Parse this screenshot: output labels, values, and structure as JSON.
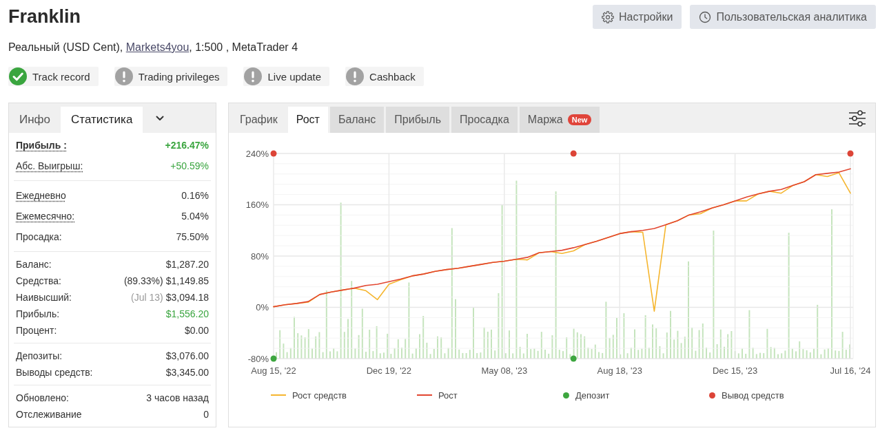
{
  "header": {
    "title": "Franklin",
    "buttons": [
      {
        "kind": "settings",
        "label": "Настройки"
      },
      {
        "kind": "analytics",
        "label": "Пользовательская аналитика"
      }
    ]
  },
  "account": {
    "text_before": "Реальный (USD Cent), ",
    "link": "Markets4you",
    "text_after": ", 1:500 , MetaTrader 4"
  },
  "badges": [
    {
      "label": "Track record",
      "verified": true
    },
    {
      "label": "Trading privileges",
      "verified": false
    },
    {
      "label": "Live update",
      "verified": false
    },
    {
      "label": "Cashback",
      "verified": false
    }
  ],
  "stats_panel": {
    "tabs": [
      {
        "label": "Инфо",
        "selected": false
      },
      {
        "label": "Статистика",
        "selected": true
      }
    ],
    "groups": [
      {
        "rows": [
          {
            "label": "Прибыль :",
            "value": "+216.47%",
            "hint": true,
            "emphasis": true,
            "positive": true
          },
          {
            "label": "Абс. Выигрыш:",
            "value": "+50.59%",
            "hint": true,
            "emphasis": false,
            "positive": true
          }
        ]
      },
      {
        "rows": [
          {
            "label": "Ежедневно",
            "value": "0.16%",
            "hint": true,
            "emphasis": false,
            "positive": false
          },
          {
            "label": "Ежемесячно:",
            "value": "5.04%",
            "hint": true,
            "emphasis": false,
            "positive": false
          },
          {
            "label": "Просадка:",
            "value": "75.50%",
            "hint": false,
            "emphasis": false,
            "positive": false
          }
        ]
      },
      {
        "rows": [
          {
            "label": "Баланс:",
            "value": "$1,287.20",
            "hint": false,
            "emphasis": false,
            "positive": false
          },
          {
            "label": "Средства:",
            "note": "(89.33%)",
            "note_muted": false,
            "value": "$1,149.85",
            "hint": false,
            "emphasis": false,
            "positive": false
          },
          {
            "label": "Наивысший:",
            "note": "(Jul 13)",
            "note_muted": true,
            "value": "$3,094.18",
            "hint": false,
            "emphasis": false,
            "positive": false
          },
          {
            "label": "Прибыль:",
            "value": "$1,556.20",
            "hint": false,
            "emphasis": false,
            "positive": true
          },
          {
            "label": "Процент:",
            "value": "$0.00",
            "hint": false,
            "emphasis": false,
            "positive": false
          }
        ]
      },
      {
        "rows": [
          {
            "label": "Депозиты:",
            "value": "$3,076.00",
            "hint": false,
            "emphasis": false,
            "positive": false
          },
          {
            "label": "Выводы средств:",
            "value": "$3,345.00",
            "hint": false,
            "emphasis": false,
            "positive": false
          }
        ]
      },
      {
        "rows": [
          {
            "label": "Обновлено:",
            "value": "3 часов назад",
            "hint": false,
            "emphasis": false,
            "positive": false
          },
          {
            "label": "Отслеживание",
            "value": "0",
            "hint": false,
            "emphasis": false,
            "positive": false
          }
        ]
      }
    ]
  },
  "chart_panel": {
    "tabs": [
      {
        "label": "График",
        "kind": "view",
        "selected": false
      },
      {
        "label": "Рост",
        "kind": "data",
        "selected": true
      },
      {
        "label": "Баланс",
        "kind": "data",
        "selected": false
      },
      {
        "label": "Прибыль",
        "kind": "data",
        "selected": false
      },
      {
        "label": "Просадка",
        "kind": "data",
        "selected": false
      },
      {
        "label": "Маржа",
        "kind": "data",
        "selected": false,
        "badge": "New"
      }
    ],
    "chart_data": {
      "type": "line",
      "grid": true,
      "legend": true,
      "categories": [
        "Aug 15, '22",
        null,
        null,
        null,
        null,
        null,
        null,
        null,
        null,
        null,
        "Dec 19, '22",
        null,
        null,
        null,
        null,
        null,
        null,
        null,
        null,
        null,
        "May 08, '23",
        null,
        null,
        null,
        null,
        null,
        null,
        null,
        null,
        null,
        "Aug 18, '23",
        null,
        null,
        null,
        null,
        null,
        null,
        null,
        null,
        null,
        "Dec 15, '23",
        null,
        null,
        null,
        null,
        null,
        null,
        null,
        null,
        null,
        "Jul 16, '24"
      ],
      "ylim": [
        -80,
        240
      ],
      "yticks": [
        {
          "value": 240,
          "label": "240%"
        },
        {
          "value": 160,
          "label": "160%"
        },
        {
          "value": 80,
          "label": "80%"
        },
        {
          "value": 0,
          "label": "0%"
        },
        {
          "value": -80,
          "label": "-80%"
        }
      ],
      "series": [
        {
          "name": "Рост средств",
          "type": "line",
          "color": "#f5b52e",
          "values": [
            1,
            4,
            6,
            8,
            20,
            24,
            27,
            30,
            26,
            12,
            36,
            43,
            49,
            52,
            56,
            59,
            61,
            64,
            67,
            70,
            72,
            75,
            74,
            85,
            87,
            84,
            88,
            98,
            103,
            109,
            115,
            118,
            117,
            -6,
            129,
            135,
            144,
            146,
            155,
            160,
            166,
            166,
            177,
            181,
            178,
            190,
            196,
            207,
            204,
            210,
            178
          ]
        },
        {
          "name": "Рост",
          "type": "line",
          "color": "#e2452f",
          "values": [
            1,
            4,
            6,
            9,
            20,
            24,
            27,
            30,
            34,
            36,
            40,
            44,
            49,
            52,
            56,
            59,
            61,
            64,
            67,
            70,
            72,
            75,
            78,
            85,
            87,
            89,
            93,
            98,
            103,
            109,
            115,
            118,
            120,
            123,
            129,
            135,
            144,
            149,
            155,
            160,
            166,
            172,
            177,
            181,
            184,
            190,
            196,
            207,
            209,
            211,
            216
          ]
        },
        {
          "name": "Депозит",
          "type": "scatter",
          "color": "#3da63f",
          "values": [
            -80,
            null,
            null,
            null,
            null,
            null,
            null,
            null,
            null,
            null,
            null,
            null,
            null,
            null,
            null,
            null,
            null,
            null,
            null,
            null,
            null,
            null,
            null,
            null,
            null,
            null,
            -80,
            null,
            null,
            null,
            null,
            null,
            null,
            null,
            null,
            null,
            null,
            null,
            null,
            null,
            null,
            null,
            null,
            null,
            null,
            null,
            null,
            null,
            null,
            null,
            null
          ]
        },
        {
          "name": "Вывод средств",
          "type": "scatter",
          "color": "#dc4437",
          "values": [
            240,
            null,
            null,
            null,
            null,
            null,
            null,
            null,
            null,
            null,
            null,
            null,
            null,
            null,
            null,
            null,
            null,
            null,
            null,
            null,
            null,
            null,
            null,
            null,
            null,
            null,
            240,
            null,
            null,
            null,
            null,
            null,
            null,
            null,
            null,
            null,
            null,
            null,
            null,
            null,
            null,
            null,
            null,
            null,
            null,
            null,
            null,
            null,
            null,
            null,
            240
          ]
        }
      ]
    }
  }
}
